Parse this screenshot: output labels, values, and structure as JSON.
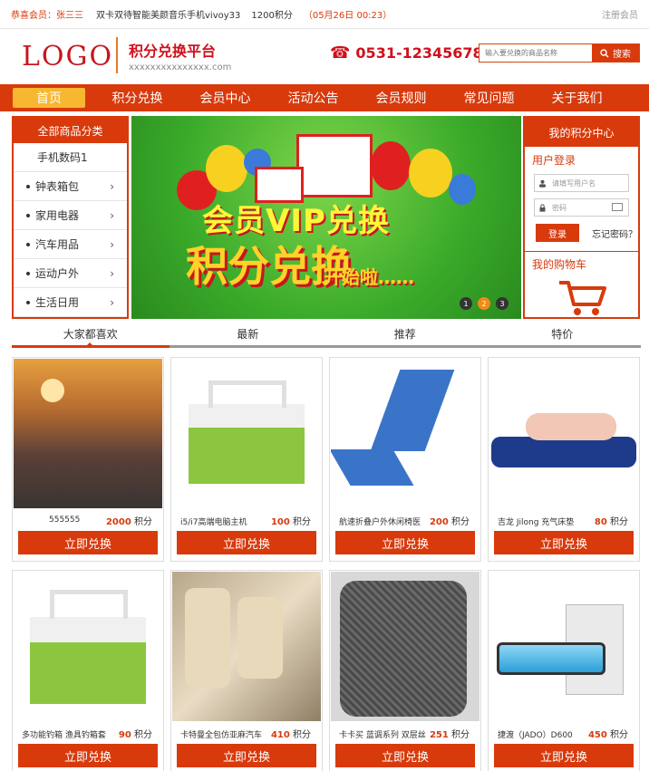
{
  "topbar": {
    "greeting": "恭喜会员：",
    "username": "张三三",
    "message": "双卡双待智能美颜音乐手机vivoy33",
    "points": "1200积分",
    "date": "（05月26日 00:23）",
    "register": "注册会员"
  },
  "header": {
    "logo": "LOGO",
    "title": "积分兑换平台",
    "url": "xxxxxxxxxxxxxxx.com",
    "phone": "0531-12345678",
    "search_placeholder": "输入要兑换的商品名称",
    "search_label": "搜索"
  },
  "nav": [
    {
      "label": "首页"
    },
    {
      "label": "积分兑换"
    },
    {
      "label": "会员中心"
    },
    {
      "label": "活动公告"
    },
    {
      "label": "会员规则"
    },
    {
      "label": "常见问题"
    },
    {
      "label": "关于我们"
    }
  ],
  "categories": {
    "title": "全部商品分类",
    "items": [
      {
        "label": "手机数码1"
      },
      {
        "label": "钟表箱包"
      },
      {
        "label": "家用电器"
      },
      {
        "label": "汽车用品"
      },
      {
        "label": "运动户外"
      },
      {
        "label": "生活日用"
      }
    ]
  },
  "banner": {
    "line1": "会员VIP兑换",
    "line2": "积分兑换",
    "line3": "开始啦……",
    "dots": [
      "1",
      "2",
      "3"
    ],
    "active_dot": 2
  },
  "member": {
    "title": "我的积分中心",
    "login_title": "用户登录",
    "username_placeholder": "请填写用户名",
    "password_placeholder": "密码",
    "login_button": "登录",
    "forgot": "忘记密码？",
    "cart_title": "我的购物车"
  },
  "tabs": [
    {
      "label": "大家都喜欢"
    },
    {
      "label": "最新"
    },
    {
      "label": "推荐"
    },
    {
      "label": "特价"
    }
  ],
  "products": [
    {
      "name": "555555",
      "points": "2000",
      "unit": "积分",
      "buy": "立即兑换"
    },
    {
      "name": "i5/i7高端电脑主机",
      "points": "100",
      "unit": "积分",
      "buy": "立即兑换"
    },
    {
      "name": "航速折叠户外休闲椅医",
      "points": "200",
      "unit": "积分",
      "buy": "立即兑换"
    },
    {
      "name": "吉龙 Jilong 充气床垫",
      "points": "80",
      "unit": "积分",
      "buy": "立即兑换"
    },
    {
      "name": "多功能钓箱 渔具钓箱套",
      "points": "90",
      "unit": "积分",
      "buy": "立即兑换"
    },
    {
      "name": "卡特曼全包仿亚麻汽车",
      "points": "410",
      "unit": "积分",
      "buy": "立即兑换"
    },
    {
      "name": "卡卡买 蓝调系列 双层丝",
      "points": "251",
      "unit": "积分",
      "buy": "立即兑换"
    },
    {
      "name": "捷渡（JADO）D600",
      "points": "450",
      "unit": "积分",
      "buy": "立即兑换"
    }
  ],
  "colors": {
    "accent": "#d83a0c",
    "highlight": "#f7b731"
  }
}
